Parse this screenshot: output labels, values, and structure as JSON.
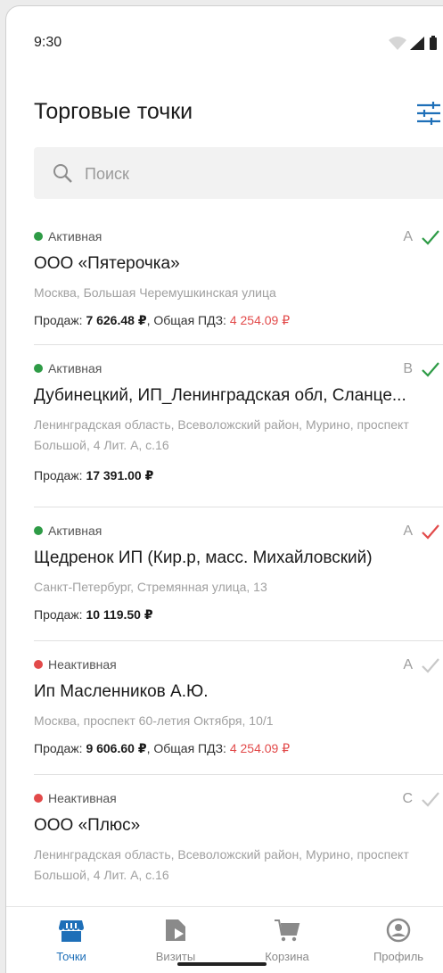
{
  "statusbar": {
    "time": "9:30"
  },
  "header": {
    "title": "Торговые точки"
  },
  "search": {
    "placeholder": "Поиск"
  },
  "colors": {
    "accent": "#1e6fb8",
    "active": "#2e9b46",
    "inactive": "#e24a4a"
  },
  "items": [
    {
      "status": "Активная",
      "status_state": "active",
      "grade": "A",
      "check_color": "#2e9b46",
      "name": "ООО «Пятерочка»",
      "addr": "Москва, Большая Черемушкинская улица",
      "sales_label": "Продаж:",
      "sales_value": "7 626.48 ₽",
      "pdz_label": ", Общая ПДЗ:",
      "pdz_value": "4 254.09 ₽"
    },
    {
      "status": "Активная",
      "status_state": "active",
      "grade": "B",
      "check_color": "#2e9b46",
      "name": "Дубинецкий, ИП_Ленинградская обл, Сланце...",
      "addr": "Ленинградская область, Всеволожский район, Мурино, проспект Большой, 4 Лит. А, с.16",
      "sales_label": "Продаж:",
      "sales_value": "17 391.00 ₽",
      "pdz_label": "",
      "pdz_value": ""
    },
    {
      "status": "Активная",
      "status_state": "active",
      "grade": "A",
      "check_color": "#e24a4a",
      "name": "Щедренок ИП (Кир.р, масс. Михайловский)",
      "addr": "Санкт-Петербург, Стремянная улица, 13",
      "sales_label": "Продаж:",
      "sales_value": "10 119.50 ₽",
      "pdz_label": "",
      "pdz_value": ""
    },
    {
      "status": "Неактивная",
      "status_state": "inactive",
      "grade": "A",
      "check_color": "#c8c8c8",
      "name": "Ип Масленников А.Ю.",
      "addr": "Москва, проспект 60-летия Октября, 10/1",
      "sales_label": "Продаж:",
      "sales_value": "9 606.60 ₽",
      "pdz_label": ", Общая ПДЗ:",
      "pdz_value": "4 254.09 ₽"
    },
    {
      "status": "Неактивная",
      "status_state": "inactive",
      "grade": "C",
      "check_color": "#c8c8c8",
      "name": "ООО «Плюс»",
      "addr": "Ленинградская область, Всеволожский район, Мурино, проспект Большой, 4 Лит. А, с.16",
      "sales_label": "",
      "sales_value": "",
      "pdz_label": "",
      "pdz_value": ""
    }
  ],
  "tabs": [
    {
      "label": "Точки",
      "icon": "store-icon",
      "active": true
    },
    {
      "label": "Визиты",
      "icon": "tag-icon",
      "active": false
    },
    {
      "label": "Корзина",
      "icon": "cart-icon",
      "active": false
    },
    {
      "label": "Профиль",
      "icon": "profile-icon",
      "active": false
    }
  ]
}
